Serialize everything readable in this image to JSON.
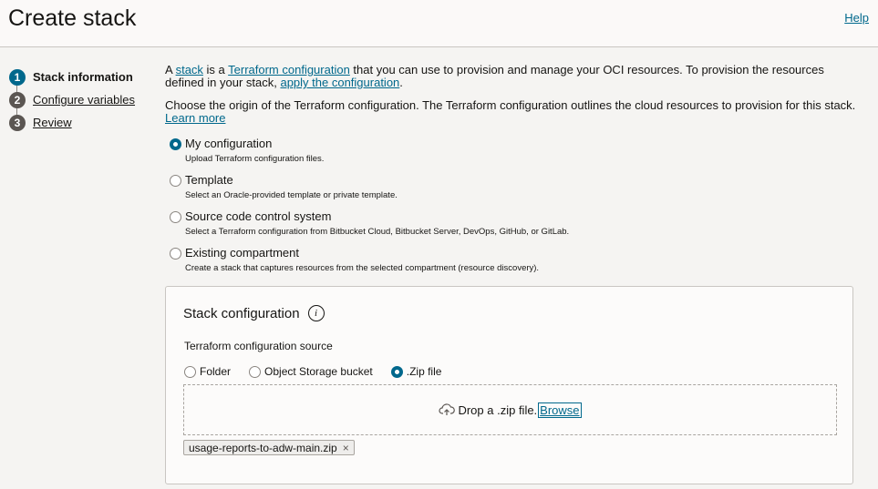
{
  "header": {
    "title": "Create stack",
    "help": "Help"
  },
  "steps": [
    {
      "num": "1",
      "label": "Stack information"
    },
    {
      "num": "2",
      "label": "Configure variables"
    },
    {
      "num": "3",
      "label": "Review"
    }
  ],
  "intro": {
    "a": "A ",
    "stack": "stack",
    "is": " is a ",
    "terraform": "Terraform configuration",
    "rest": " that you can use to provision and manage your OCI resources. To provision the resources defined in your stack, ",
    "apply": "apply the configuration",
    "end": "."
  },
  "origin": {
    "text": "Choose the origin of the Terraform configuration. The Terraform configuration outlines the cloud resources to provision for this stack. ",
    "learn": "Learn more"
  },
  "options": [
    {
      "label": "My configuration",
      "desc": "Upload Terraform configuration files.",
      "selected": true
    },
    {
      "label": "Template",
      "desc": "Select an Oracle-provided template or private template.",
      "selected": false
    },
    {
      "label": "Source code control system",
      "desc": "Select a Terraform configuration from Bitbucket Cloud, Bitbucket Server, DevOps, GitHub, or GitLab.",
      "selected": false
    },
    {
      "label": "Existing compartment",
      "desc": "Create a stack that captures resources from the selected compartment (resource discovery).",
      "selected": false
    }
  ],
  "panel": {
    "title": "Stack configuration",
    "source_label": "Terraform configuration source",
    "sources": [
      {
        "label": "Folder",
        "selected": false
      },
      {
        "label": "Object Storage bucket",
        "selected": false
      },
      {
        "label": ".Zip file",
        "selected": true
      }
    ],
    "drop_text": "Drop a .zip file.",
    "browse": "Browse",
    "file": "usage-reports-to-adw-main.zip"
  }
}
